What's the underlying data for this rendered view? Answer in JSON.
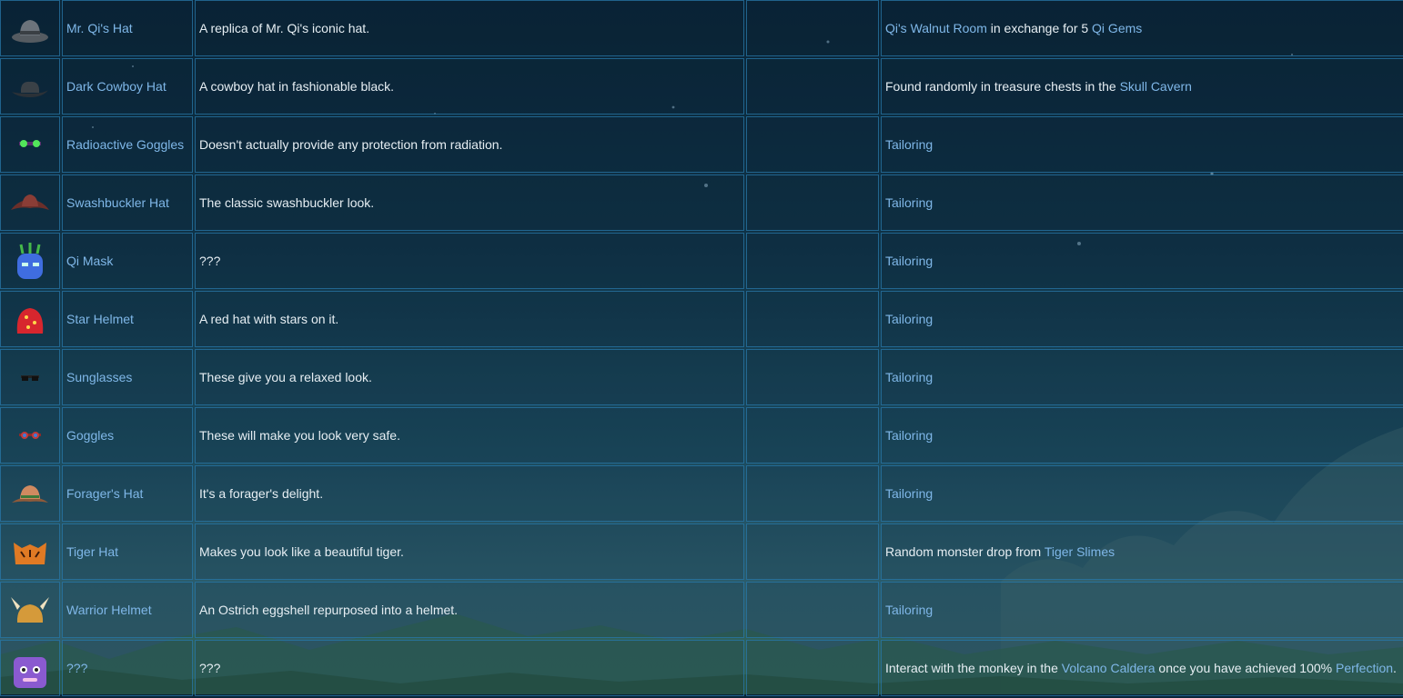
{
  "table": {
    "rows": [
      {
        "icon": "qi-hat-icon",
        "name": "Mr. Qi's Hat",
        "desc": "A replica of Mr. Qi's iconic hat.",
        "price": "",
        "source": [
          {
            "t": "Qi's Walnut Room",
            "link": true
          },
          {
            "t": " in exchange for 5 ",
            "link": false
          },
          {
            "t": "Qi Gems",
            "link": true
          }
        ]
      },
      {
        "icon": "dark-cowboy-hat-icon",
        "name": "Dark Cowboy Hat",
        "desc": "A cowboy hat in fashionable black.",
        "price": "",
        "source": [
          {
            "t": "Found randomly in treasure chests in the ",
            "link": false
          },
          {
            "t": "Skull Cavern",
            "link": true
          }
        ]
      },
      {
        "icon": "radioactive-goggles-icon",
        "name": "Radioactive Goggles",
        "desc": "Doesn't actually provide any protection from radiation.",
        "price": "",
        "source": [
          {
            "t": "Tailoring",
            "link": true
          }
        ]
      },
      {
        "icon": "swashbuckler-hat-icon",
        "name": "Swashbuckler Hat",
        "desc": "The classic swashbuckler look.",
        "price": "",
        "source": [
          {
            "t": "Tailoring",
            "link": true
          }
        ]
      },
      {
        "icon": "qi-mask-icon",
        "name": "Qi Mask",
        "desc": "???",
        "price": "",
        "source": [
          {
            "t": "Tailoring",
            "link": true
          }
        ]
      },
      {
        "icon": "star-helmet-icon",
        "name": "Star Helmet",
        "desc": "A red hat with stars on it.",
        "price": "",
        "source": [
          {
            "t": "Tailoring",
            "link": true
          }
        ]
      },
      {
        "icon": "sunglasses-icon",
        "name": "Sunglasses",
        "desc": "These give you a relaxed look.",
        "price": "",
        "source": [
          {
            "t": "Tailoring",
            "link": true
          }
        ]
      },
      {
        "icon": "goggles-icon",
        "name": "Goggles",
        "desc": "These will make you look very safe.",
        "price": "",
        "source": [
          {
            "t": "Tailoring",
            "link": true
          }
        ]
      },
      {
        "icon": "foragers-hat-icon",
        "name": "Forager's Hat",
        "desc": "It's a forager's delight.",
        "price": "",
        "source": [
          {
            "t": "Tailoring",
            "link": true
          }
        ]
      },
      {
        "icon": "tiger-hat-icon",
        "name": "Tiger Hat",
        "desc": "Makes you look like a beautiful tiger.",
        "price": "",
        "source": [
          {
            "t": "Random monster drop from ",
            "link": false
          },
          {
            "t": "Tiger Slimes",
            "link": true
          }
        ]
      },
      {
        "icon": "warrior-helmet-icon",
        "name": "Warrior Helmet",
        "desc": "An Ostrich eggshell repurposed into a helmet.",
        "price": "",
        "source": [
          {
            "t": "Tailoring",
            "link": true
          }
        ]
      },
      {
        "icon": "mystery-hat-icon",
        "name": "???",
        "desc": "???",
        "price": "",
        "source": [
          {
            "t": "Interact with the monkey in the ",
            "link": false
          },
          {
            "t": "Volcano Caldera",
            "link": true
          },
          {
            "t": " once you have achieved 100% ",
            "link": false
          },
          {
            "t": "Perfection",
            "link": true
          },
          {
            "t": ".",
            "link": false
          }
        ]
      }
    ]
  },
  "colors": {
    "link": "#7fb7e8",
    "text": "#e6eef3",
    "border": "#2878aa"
  }
}
